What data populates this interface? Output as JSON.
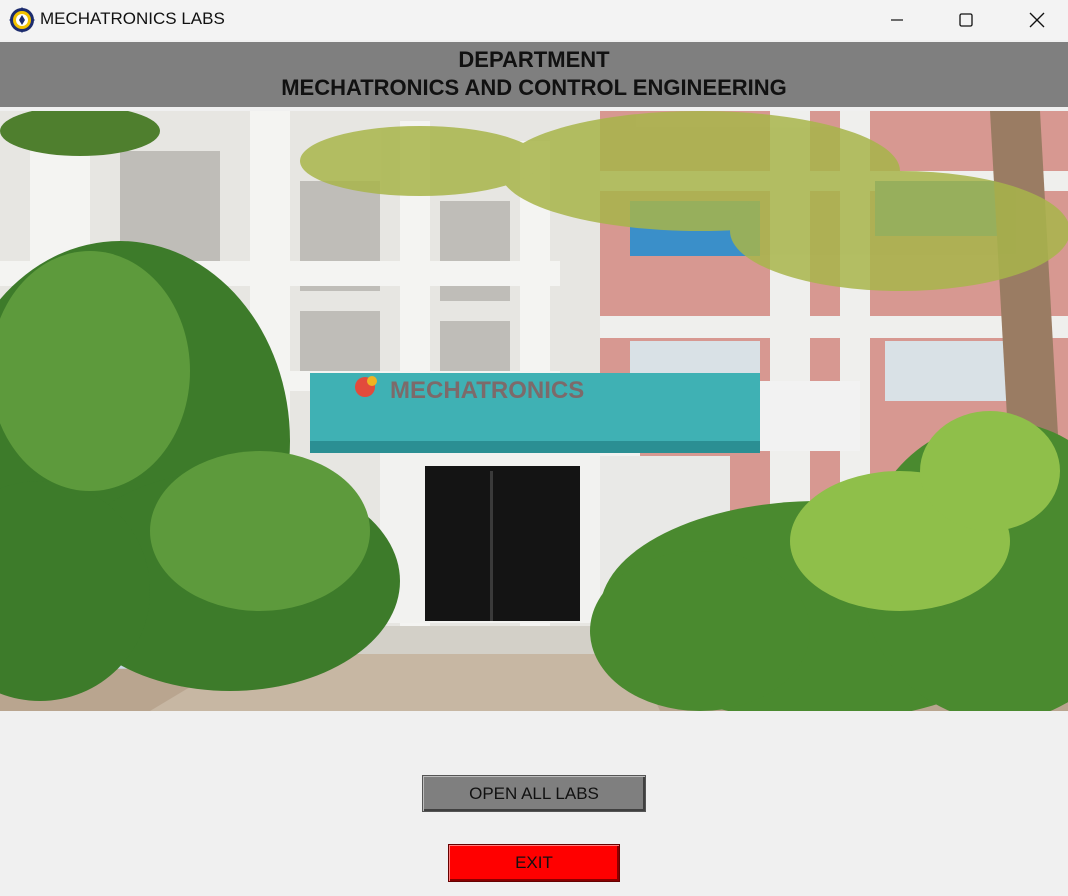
{
  "window": {
    "title": "MECHATRONICS LABS",
    "icon": "university-seal-icon",
    "controls": [
      "minimize-icon",
      "maximize-icon",
      "close-icon"
    ]
  },
  "header": {
    "line1": "DEPARTMENT",
    "line2": "MECHATRONICS AND CONTROL ENGINEERING",
    "background": "#7f7f7f"
  },
  "photo": {
    "sign_text": "MECHATRONICS"
  },
  "buttons": {
    "open_all_labs": {
      "label": "OPEN ALL LABS",
      "color": "#7f7f7f"
    },
    "exit": {
      "label": "EXIT",
      "color": "#ff0000"
    }
  }
}
